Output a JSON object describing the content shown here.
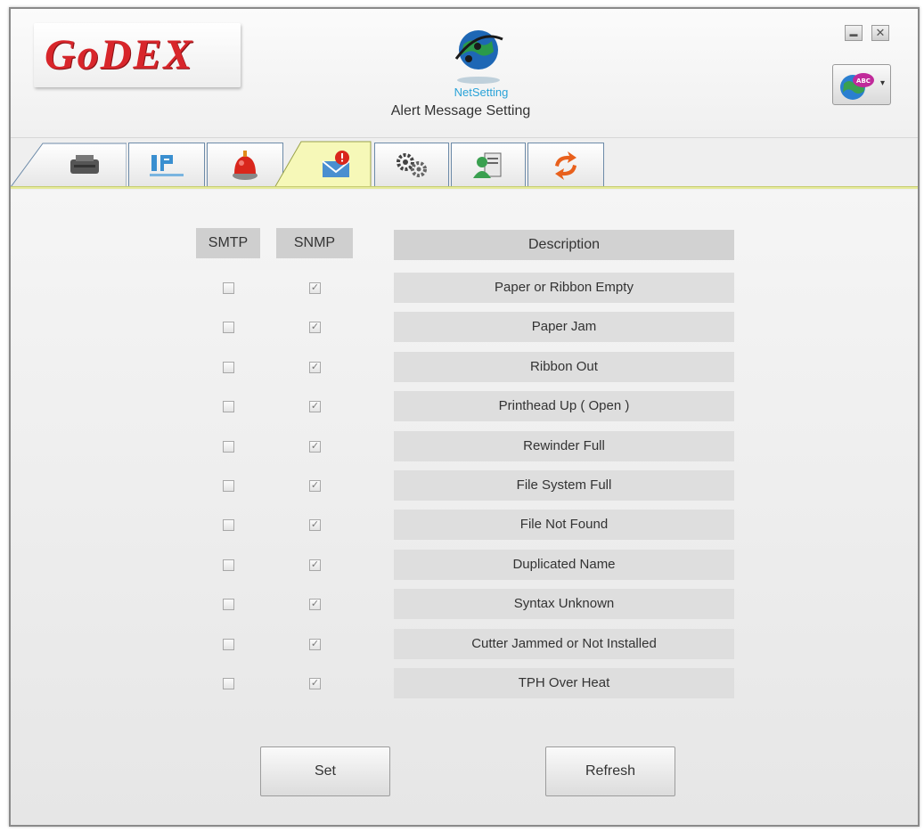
{
  "header": {
    "logo_text": "GoDEX",
    "netsetting_label": "NetSetting",
    "subtitle": "Alert Message Setting"
  },
  "window_controls": {
    "minimize": "▬",
    "close": "✕"
  },
  "language": {
    "icon": "globe-abc-icon",
    "arrow": "▾"
  },
  "tabs": [
    {
      "name": "printer-tab",
      "icon": "printer-icon"
    },
    {
      "name": "ip-network-tab",
      "icon": "ip-network-icon"
    },
    {
      "name": "alert-tab",
      "icon": "alarm-light-icon"
    },
    {
      "name": "alert-message-tab",
      "icon": "email-alert-icon",
      "active": true
    },
    {
      "name": "settings-tab",
      "icon": "gears-icon"
    },
    {
      "name": "user-tab",
      "icon": "user-document-icon"
    },
    {
      "name": "refresh-tab",
      "icon": "sync-icon"
    }
  ],
  "columns": {
    "smtp": "SMTP",
    "snmp": "SNMP",
    "description": "Description"
  },
  "rows": [
    {
      "description": "Paper or Ribbon Empty",
      "smtp": false,
      "snmp": true
    },
    {
      "description": "Paper Jam",
      "smtp": false,
      "snmp": true
    },
    {
      "description": "Ribbon Out",
      "smtp": false,
      "snmp": true
    },
    {
      "description": "Printhead Up ( Open )",
      "smtp": false,
      "snmp": true
    },
    {
      "description": "Rewinder Full",
      "smtp": false,
      "snmp": true
    },
    {
      "description": "File System Full",
      "smtp": false,
      "snmp": true
    },
    {
      "description": "File Not Found",
      "smtp": false,
      "snmp": true
    },
    {
      "description": "Duplicated Name",
      "smtp": false,
      "snmp": true
    },
    {
      "description": "Syntax Unknown",
      "smtp": false,
      "snmp": true
    },
    {
      "description": "Cutter Jammed or Not Installed",
      "smtp": false,
      "snmp": true
    },
    {
      "description": "TPH Over Heat",
      "smtp": false,
      "snmp": true
    }
  ],
  "buttons": {
    "set": "Set",
    "refresh": "Refresh"
  },
  "colors": {
    "brand_red": "#d8262b",
    "active_tab": "#f2f59e",
    "netsetting_blue": "#2aa3d8"
  }
}
